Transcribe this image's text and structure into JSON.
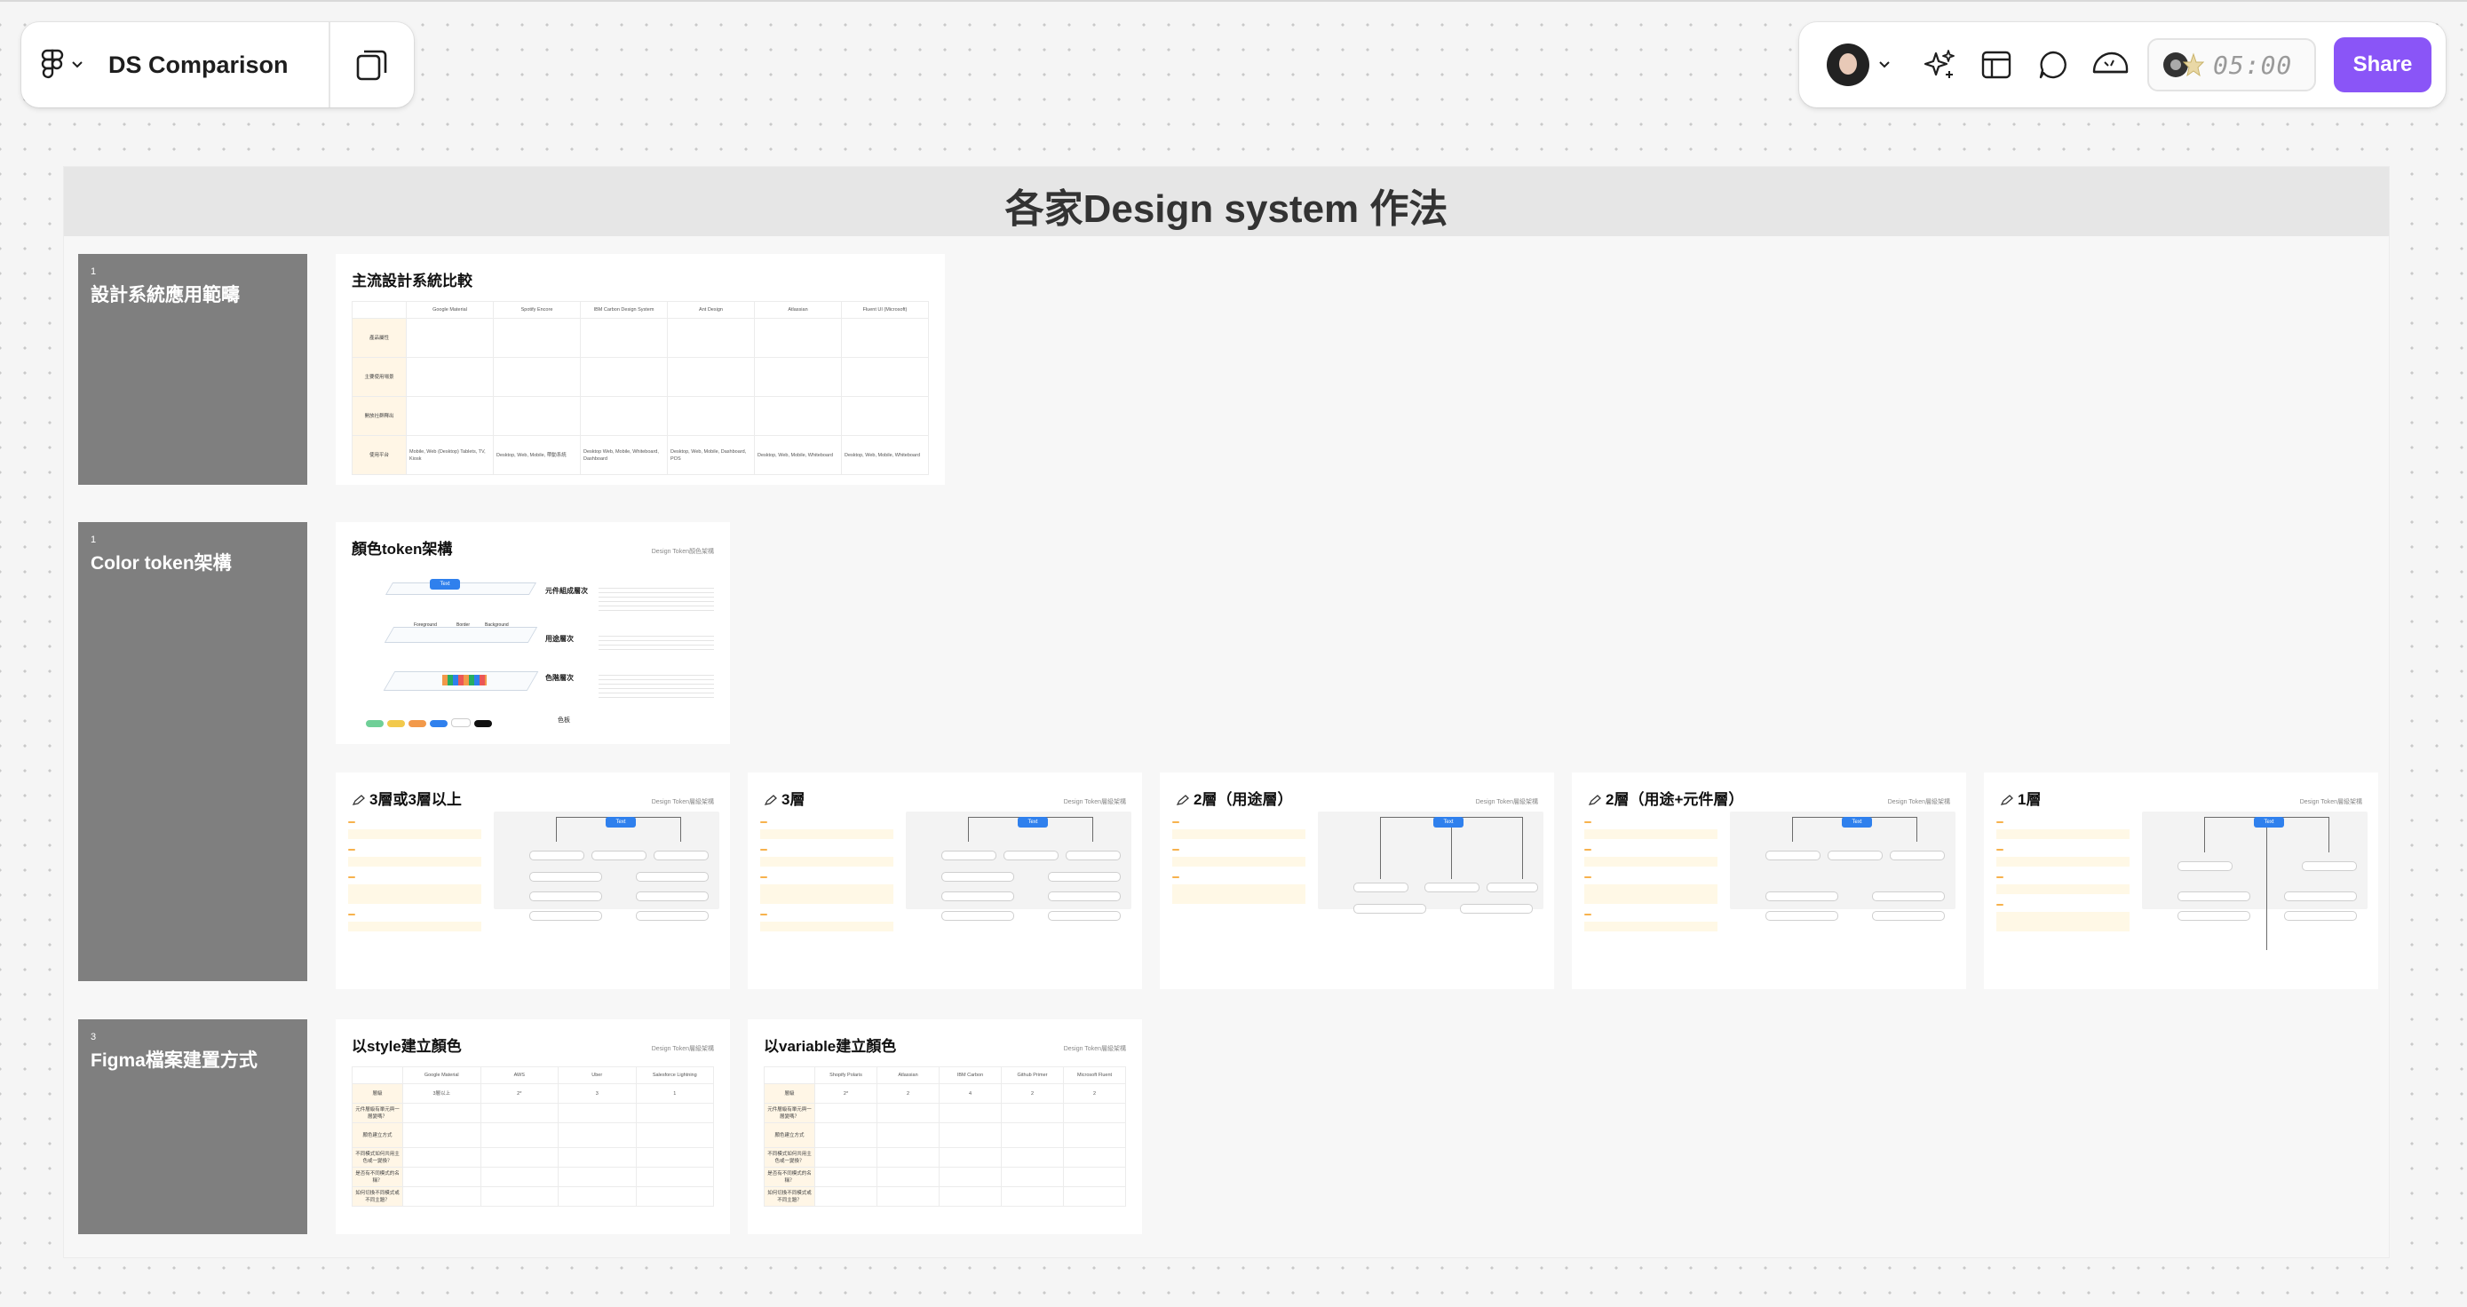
{
  "app": {
    "file_name": "DS Comparison",
    "timer": "05:00",
    "share_label": "Share"
  },
  "icons": {
    "logo": "figma-logo-icon",
    "pages": "pages-icon",
    "ai": "sparkle-ai-icon",
    "layout": "layout-panel-icon",
    "comment": "comment-icon",
    "presence": "cursor-chat-icon"
  },
  "colors": {
    "accent": "#8a55f7",
    "section_header": "#e6e6e6",
    "row_label": "#7f7f7f",
    "text_node": "#2f80ed"
  },
  "section": {
    "title": "各家Design system 作法",
    "rows": [
      {
        "num": "1",
        "title": "設計系統應用範疇"
      },
      {
        "num": "1",
        "title": "Color token架構"
      },
      {
        "num": "3",
        "title": "Figma檔案建置方式"
      }
    ]
  },
  "cards": {
    "comparison": {
      "title": "主流設計系統比較",
      "columns": [
        "Google Material",
        "Spotify Encore",
        "IBM Carbon Design System",
        "Ant Design",
        "Atlassian",
        "Fluent UI (Microsoft)"
      ],
      "row_heads": [
        "產品屬性",
        "主要使用場景",
        "開放社群釋出",
        "使用平台"
      ],
      "platforms": [
        "Mobile, Web (Desktop) Tablets, TV, Kiosk",
        "Desktop, Web, Mobile, 帶動系統",
        "Desktop Web, Mobile, Whiteboard, Dashboard",
        "Desktop, Web, Mobile, Dashboard, POS",
        "Desktop, Web, Mobile, Whiteboard",
        "Desktop, Web, Mobile, Whiteboard"
      ]
    },
    "token_arch": {
      "title": "顏色token架構",
      "meta": "Design Token顏色架構",
      "layers": [
        "元件組成層次",
        "用途層次",
        "色階層次"
      ],
      "layer_labels": [
        "Foreground",
        "Border",
        "Background"
      ],
      "node_text": "Text",
      "palette_label": "色板"
    },
    "level_cards": [
      {
        "title": "3層或3層以上",
        "meta": "Design Token層級架構"
      },
      {
        "title": "3層",
        "meta": "Design Token層級架構"
      },
      {
        "title": "2層（用途層）",
        "meta": "Design Token層級架構"
      },
      {
        "title": "2層（用途+元件層）",
        "meta": "Design Token層級架構"
      },
      {
        "title": "1層",
        "meta": "Design Token層級架構"
      }
    ],
    "style_card": {
      "title": "以style建立顏色",
      "meta": "Design Token層級架構",
      "columns": [
        "Google Material",
        "AWS",
        "Uber",
        "Salesforce Lightning"
      ],
      "row_heads": [
        "層級",
        "元件層級有單元與一層變嗎？",
        "顏色建立方式",
        "不同模式如何共用主色或一變換？",
        "是否有不同模式的名稱？",
        "如何切換不同模式或不同主題？"
      ],
      "first_row": [
        "3層以上",
        "2*",
        "3",
        "1"
      ]
    },
    "variable_card": {
      "title": "以variable建立顏色",
      "meta": "Design Token層級架構",
      "columns": [
        "Shopify Polaris",
        "Atlassian",
        "IBM Carbon",
        "Github Primer",
        "Microsoft Fluent"
      ],
      "row_heads": [
        "層級",
        "元件層級有單元與一層變嗎？",
        "顏色建立方式",
        "不同模式如何共用主色或一變換？",
        "是否有不同模式的名稱？",
        "如何切換不同模式或不同主題？"
      ],
      "first_row": [
        "2*",
        "2",
        "4",
        "2",
        "2"
      ]
    }
  }
}
